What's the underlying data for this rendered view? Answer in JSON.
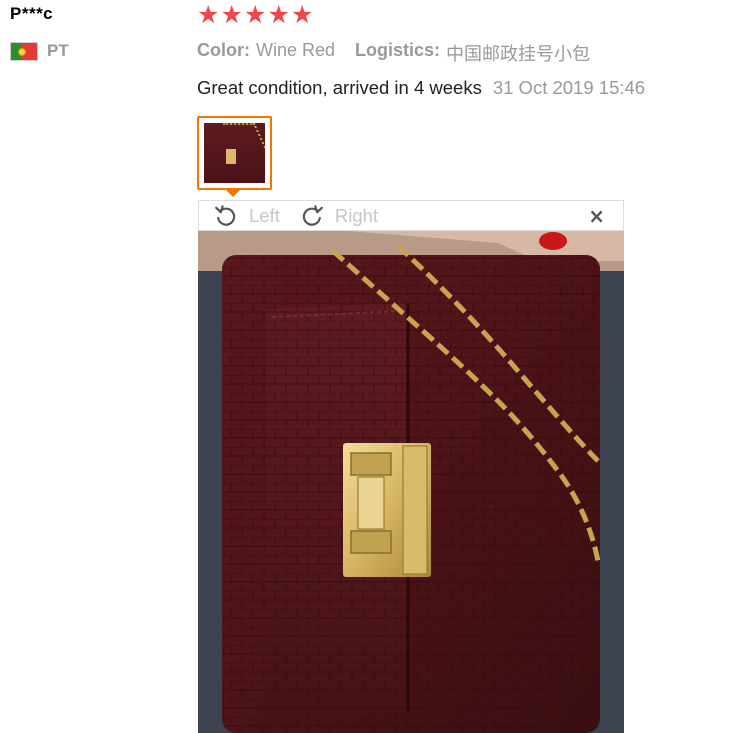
{
  "user": {
    "name": "P***c",
    "country_code": "PT",
    "flag_icon": "portugal-flag-icon"
  },
  "rating": {
    "stars": 5,
    "max_stars": 5,
    "star_color": "#f04848"
  },
  "attributes": [
    {
      "key": "Color:",
      "value": "Wine Red"
    },
    {
      "key": "Logistics:",
      "value": "中国邮政挂号小包"
    }
  ],
  "review": {
    "text": "Great condition, arrived in 4 weeks",
    "date": "31 Oct 2019 15:46"
  },
  "viewer": {
    "rotate_left_label": "Left",
    "rotate_right_label": "Right",
    "close_symbol": "×",
    "thumbnail_border_color": "#f07800",
    "photo_subject": "wine red crocodile-embossed chain shoulder bag with gold twist-lock clasp"
  }
}
